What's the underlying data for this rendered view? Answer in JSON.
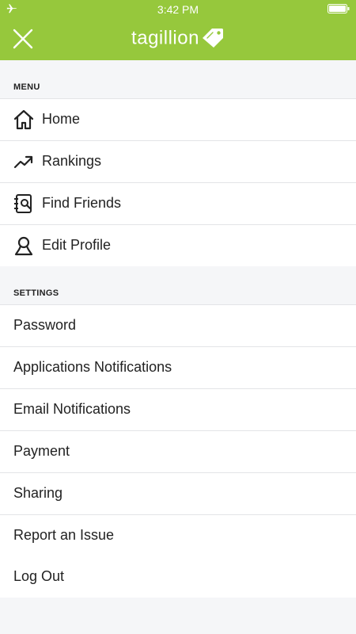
{
  "status_bar": {
    "time": "3:42 PM",
    "airplane_icon": "airplane-icon",
    "battery_icon": "battery-icon"
  },
  "header": {
    "title": "tagillion",
    "close_icon": "close-icon",
    "logo_icon": "tag-icon",
    "background_color": "#96c83c"
  },
  "menu": {
    "heading": "MENU",
    "items": [
      {
        "label": "Home",
        "icon": "home-icon"
      },
      {
        "label": "Rankings",
        "icon": "trend-up-icon"
      },
      {
        "label": "Find Friends",
        "icon": "contact-book-search-icon"
      },
      {
        "label": "Edit Profile",
        "icon": "user-icon"
      }
    ]
  },
  "settings": {
    "heading": "SETTINGS",
    "items": [
      {
        "label": "Password"
      },
      {
        "label": "Applications Notifications"
      },
      {
        "label": "Email Notifications"
      },
      {
        "label": "Payment"
      },
      {
        "label": "Sharing"
      },
      {
        "label": "Report an Issue"
      },
      {
        "label": "Log Out"
      }
    ]
  }
}
